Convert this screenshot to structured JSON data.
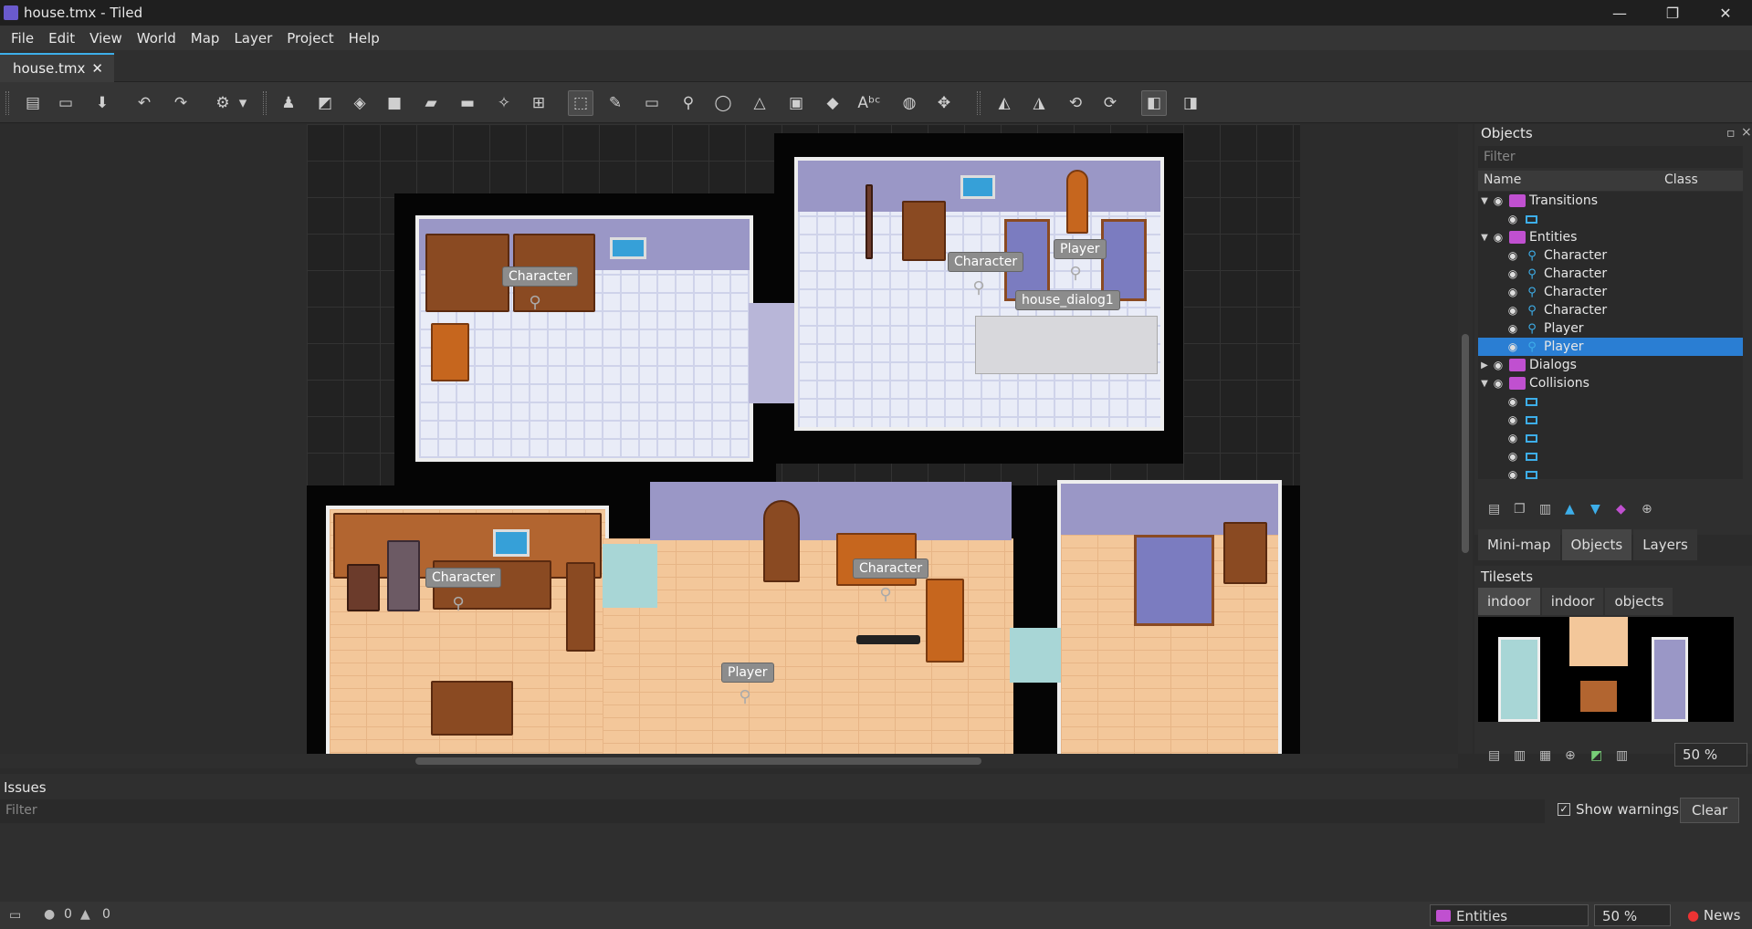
{
  "window": {
    "title": "house.tmx - Tiled",
    "minimize": "—",
    "maximize": "❐",
    "close": "✕"
  },
  "menu": [
    "File",
    "Edit",
    "View",
    "World",
    "Map",
    "Layer",
    "Project",
    "Help"
  ],
  "tab": {
    "label": "house.tmx",
    "close": "✕"
  },
  "map_labels": {
    "character1": "Character",
    "character2": "Character",
    "character3": "Character",
    "character4": "Character",
    "player1": "Player",
    "player2": "Player",
    "dialog": "house_dialog1"
  },
  "objects_panel": {
    "title": "Objects",
    "filter_placeholder": "Filter",
    "col_name": "Name",
    "col_class": "Class",
    "tree": [
      {
        "type": "layer",
        "label": "Transitions",
        "expanded": true
      },
      {
        "type": "rect",
        "label": ""
      },
      {
        "type": "layer",
        "label": "Entities",
        "expanded": true
      },
      {
        "type": "point",
        "label": "Character"
      },
      {
        "type": "point",
        "label": "Character"
      },
      {
        "type": "point",
        "label": "Character"
      },
      {
        "type": "point",
        "label": "Character"
      },
      {
        "type": "point",
        "label": "Player"
      },
      {
        "type": "point",
        "label": "Player",
        "selected": true
      },
      {
        "type": "layer",
        "label": "Dialogs",
        "expanded": false
      },
      {
        "type": "layer",
        "label": "Collisions",
        "expanded": true
      },
      {
        "type": "rect",
        "label": ""
      },
      {
        "type": "rect",
        "label": ""
      },
      {
        "type": "rect",
        "label": ""
      },
      {
        "type": "rect",
        "label": ""
      },
      {
        "type": "rect",
        "label": ""
      }
    ]
  },
  "panel_tabs": [
    "Mini-map",
    "Objects",
    "Layers"
  ],
  "tilesets": {
    "title": "Tilesets",
    "tabs": [
      "indoor",
      "indoor",
      "objects"
    ],
    "zoom": "50 %"
  },
  "issues": {
    "title": "Issues",
    "filter_placeholder": "Filter",
    "show_warnings": "Show warnings",
    "clear": "Clear"
  },
  "status": {
    "errors": "0",
    "warnings": "0",
    "layer": "Entities",
    "zoom": "50 %",
    "news": "News"
  },
  "colors": {
    "accent": "#3daee9",
    "selection": "#2a7ed3",
    "layer_icon": "#c050d0"
  }
}
